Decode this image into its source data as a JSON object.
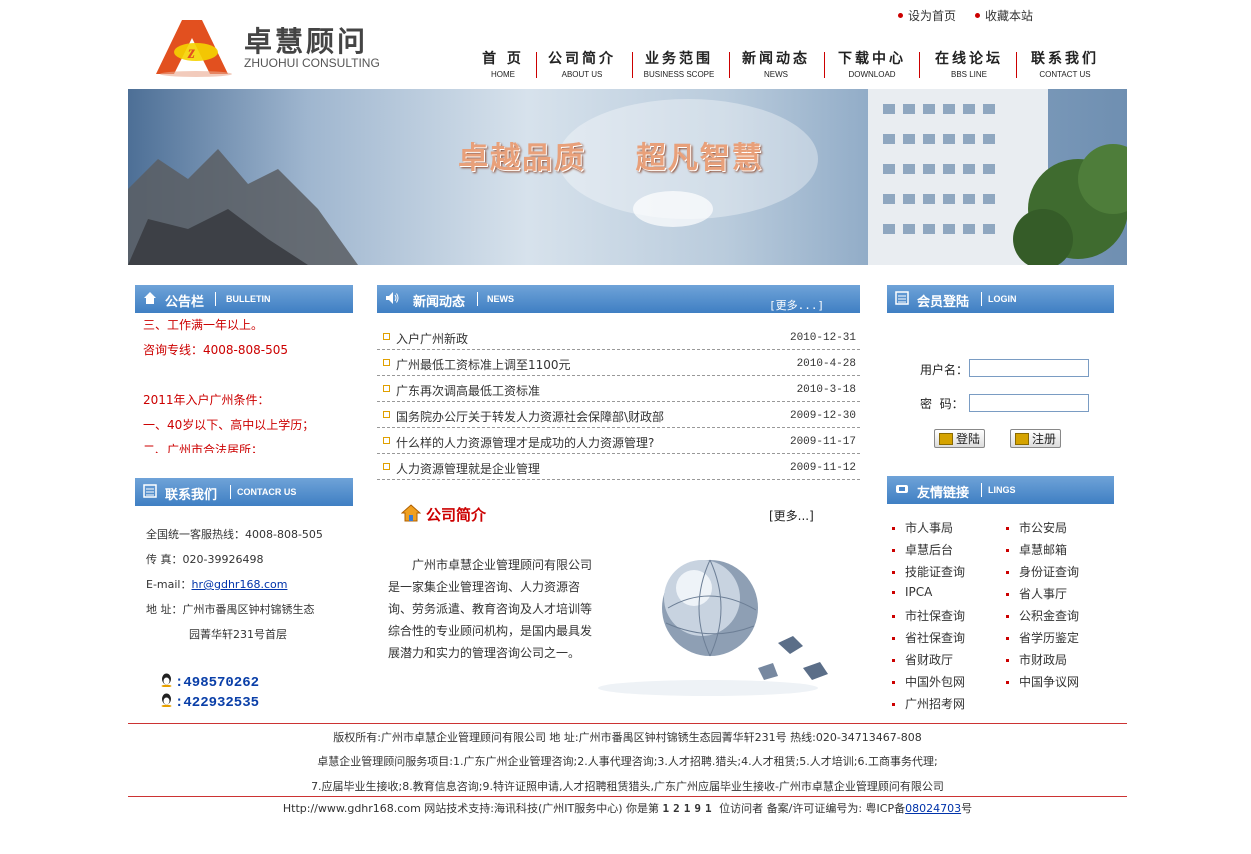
{
  "header": {
    "logo_cn": "卓慧顾问",
    "logo_en": "ZHUOHUI CONSULTING",
    "top_links": [
      "设为首页",
      "收藏本站"
    ]
  },
  "nav": [
    {
      "cn": "首 页",
      "en": "HOME"
    },
    {
      "cn": "公司简介",
      "en": "ABOUT US"
    },
    {
      "cn": "业务范围",
      "en": "BUSINESS SCOPE"
    },
    {
      "cn": "新闻动态",
      "en": "NEWS"
    },
    {
      "cn": "下载中心",
      "en": "DOWNLOAD"
    },
    {
      "cn": "在线论坛",
      "en": "BBS LINE"
    },
    {
      "cn": "联系我们",
      "en": "CONTACT US"
    }
  ],
  "banner": {
    "slogan": "卓越品质    超凡智慧"
  },
  "bulletin": {
    "title": "公告栏",
    "title_en": "BULLETIN",
    "lines": [
      "三、工作满一年以上。",
      "咨询专线：4008-808-505",
      "",
      "2011年入户广州条件：",
      "一、40岁以下、高中以上学历；",
      "二、广州市合法居所；"
    ]
  },
  "contact": {
    "title": "联系我们",
    "title_en": "CONTACR US",
    "hotline": "全国统一客服热线：4008-808-505",
    "fax": "传 真：020-39926498",
    "email_label": "E-mail：",
    "email": "hr@gdhr168.com",
    "address1": "地 址：广州市番禺区钟村锦锈生态",
    "address2": "园菁华轩231号首层",
    "qq": [
      ":498570262",
      ":422932535"
    ]
  },
  "news": {
    "title": "新闻动态",
    "title_en": "NEWS",
    "more": "[更多...]",
    "items": [
      {
        "title": "入户广州新政",
        "date": "2010-12-31"
      },
      {
        "title": "广州最低工资标准上调至1100元",
        "date": "2010-4-28"
      },
      {
        "title": "广东再次调高最低工资标准",
        "date": "2010-3-18"
      },
      {
        "title": "国务院办公厅关于转发人力资源社会保障部\\财政部",
        "date": "2009-12-30"
      },
      {
        "title": "什么样的人力资源管理才是成功的人力资源管理?",
        "date": "2009-11-17"
      },
      {
        "title": "人力资源管理就是企业管理",
        "date": "2009-11-12"
      }
    ]
  },
  "about": {
    "title": "公司简介",
    "more": "[更多...]",
    "text": "广州市卓慧企业管理顾问有限公司是一家集企业管理咨询、人力资源咨询、劳务派遣、教育咨询及人才培训等综合性的专业顾问机构，是国内最具发展潜力和实力的管理咨询公司之一。"
  },
  "login": {
    "title": "会员登陆",
    "title_en": "LOGIN",
    "username_label": "用户名：",
    "password_label": "密  码：",
    "login_btn": "登陆",
    "register_btn": "注册"
  },
  "links": {
    "title": "友情链接",
    "title_en": "LINGS",
    "items": [
      "市人事局",
      "市公安局",
      "卓慧后台",
      "卓慧邮箱",
      "技能证查询",
      "身份证查询",
      "IPCA",
      "省人事厅",
      "市社保查询",
      "公积金查询",
      "省社保查询",
      "省学历鉴定",
      "省财政厅",
      "市财政局",
      "中国外包网",
      "中国争议网",
      "广州招考网"
    ]
  },
  "footer": {
    "line1": "版权所有:广州市卓慧企业管理顾问有限公司    地 址:广州市番禺区钟村锦锈生态园菁华轩231号  热线:020-34713467-808",
    "line2": "卓慧企业管理顾问服务项目:1.广东广州企业管理咨询;2.人事代理咨询;3.人才招聘.猎头;4.人才租赁;5.人才培训;6.工商事务代理;",
    "line3": "7.应届毕业生接收;8.教育信息咨询;9.特许证照申请,人才招聘租赁猎头,广东广州应届毕业生接收-广州市卓慧企业管理顾问有限公司",
    "line4_pre": "Http://www.gdhr168.com   网站技术支持:海讯科技(广州IT服务中心)   你是第",
    "visitor_count": "12191",
    "line4_mid": "位访问者   备案/许可证编号为: 粤ICP备",
    "icp": "08024703",
    "line4_post": "号"
  }
}
